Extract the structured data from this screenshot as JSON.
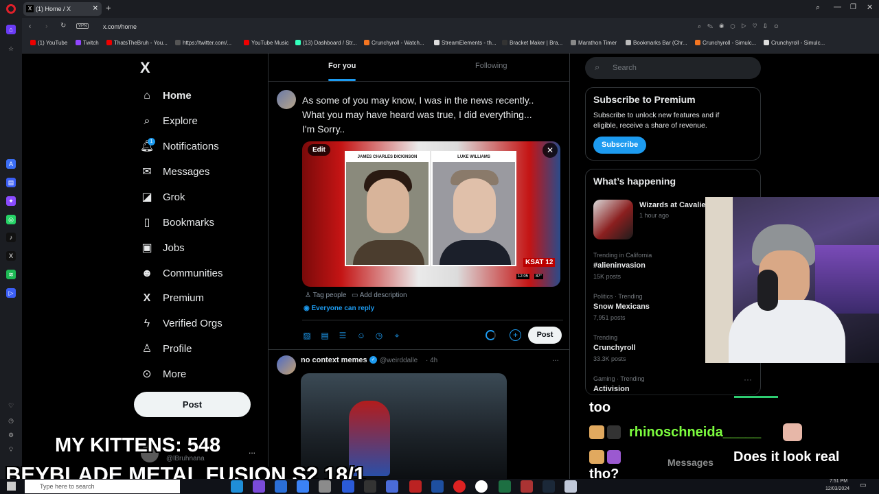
{
  "browser": {
    "tab_title": "(1) Home / X",
    "url": "x.com/home",
    "vpn_label": "VPN",
    "bookmarks": [
      "(1) YouTube",
      "Twitch",
      "ThatsTheBruh - You...",
      "https://twitter.com/...",
      "YouTube Music",
      "(13) Dashboard / Str...",
      "Crunchyroll - Watch...",
      "StreamElements - th...",
      "Bracket Maker | Bra...",
      "Marathon Timer",
      "Bookmarks Bar (Chr...",
      "Crunchyroll - Simulc...",
      "Crunchyroll - Simulc..."
    ]
  },
  "sidebar": {
    "logo": "X",
    "items": [
      {
        "label": "Home",
        "icon": "home-icon"
      },
      {
        "label": "Explore",
        "icon": "search-icon"
      },
      {
        "label": "Notifications",
        "icon": "bell-icon"
      },
      {
        "label": "Messages",
        "icon": "envelope-icon"
      },
      {
        "label": "Grok",
        "icon": "grok-icon"
      },
      {
        "label": "Bookmarks",
        "icon": "bookmark-icon"
      },
      {
        "label": "Jobs",
        "icon": "briefcase-icon"
      },
      {
        "label": "Communities",
        "icon": "people-icon"
      },
      {
        "label": "Premium",
        "icon": "x-icon"
      },
      {
        "label": "Verified Orgs",
        "icon": "lightning-icon"
      },
      {
        "label": "Profile",
        "icon": "person-icon"
      },
      {
        "label": "More",
        "icon": "more-circle-icon"
      }
    ],
    "notification_badge": "1",
    "post_label": "Post",
    "account_handle": "@lBruhnana",
    "account_more": "..."
  },
  "feed": {
    "tabs": [
      "For you",
      "Following"
    ],
    "composer": {
      "text": "As some of you may know, I was in the news recently..\nWhat you may have heard was true, I did everything...\nI'm Sorry..",
      "edit_label": "Edit",
      "mug_left_name": "JAMES CHARLES DICKINSON",
      "mug_right_name": "LUKE WILLIAMS",
      "station_logo": "KSAT 12",
      "station_time": "12:05",
      "station_temp": "87°",
      "tag_people": "Tag people",
      "add_description": "Add description",
      "reply_setting": "Everyone can reply",
      "post_label": "Post"
    },
    "tweet": {
      "author": "no context memes",
      "handle": "@weirddalle",
      "time": "· 4h",
      "more": "..."
    }
  },
  "right": {
    "search_placeholder": "Search",
    "premium": {
      "title": "Subscribe to Premium",
      "body": "Subscribe to unlock new features and if eligible, receive a share of revenue.",
      "button": "Subscribe"
    },
    "happening": {
      "title": "What’s happening",
      "event_title": "Wizards at Cavalie",
      "event_time": "1 hour ago",
      "trends": [
        {
          "meta": "Trending in California",
          "name": "#alieninvasion",
          "count": "15K posts"
        },
        {
          "meta": "Politics · Trending",
          "name": "Snow Mexicans",
          "count": "7,951 posts"
        },
        {
          "meta": "Trending",
          "name": "Crunchyroll",
          "count": "33.3K posts"
        },
        {
          "meta": "Gaming · Trending",
          "name": "Activision",
          "count": ""
        }
      ]
    }
  },
  "overlay": {
    "kittens": "MY KITTENS: 548",
    "beyblade": "BEYBLADE METAL FUSION S2 18/1",
    "chat": {
      "line1": "too",
      "user": "rhinoschneida_____",
      "message": "Does it look real",
      "message2": "tho?",
      "messages_tab": "Messages"
    }
  },
  "taskbar": {
    "search_placeholder": "Type here to search",
    "time": "7:51 PM",
    "date": "12/03/2024"
  },
  "colors": {
    "accent": "#1d9bf0",
    "background": "#000000",
    "chat_user": "#7cfc3e"
  }
}
